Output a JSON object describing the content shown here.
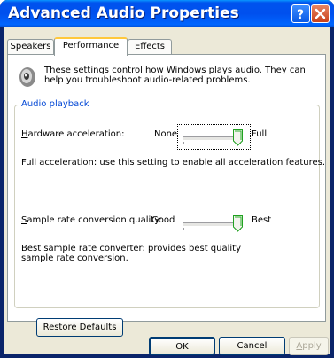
{
  "window": {
    "title": "Advanced Audio Properties"
  },
  "titlebar": {
    "help_icon": "help-question-icon",
    "close_icon": "close-x-icon"
  },
  "tabs": [
    {
      "label": "Speakers",
      "active": false
    },
    {
      "label": "Performance",
      "active": true
    },
    {
      "label": "Effects",
      "active": false
    }
  ],
  "intro": {
    "icon": "speaker-icon",
    "text": "These settings control how Windows plays audio. They can help you troubleshoot audio-related problems."
  },
  "group": {
    "title": "Audio playback"
  },
  "hardware_acceleration": {
    "label": "Hardware acceleration:",
    "min_label": "None",
    "max_label": "Full",
    "value_position": 1.0,
    "description": "Full acceleration: use this setting to enable all acceleration features."
  },
  "sample_rate_quality": {
    "label": "Sample rate conversion quality:",
    "min_label": "Good",
    "max_label": "Best",
    "value_position": 1.0,
    "description": "Best sample rate converter:  provides best quality sample rate conversion."
  },
  "buttons": {
    "restore_defaults": "Restore Defaults",
    "ok": "OK",
    "cancel": "Cancel",
    "apply": "Apply"
  },
  "colors": {
    "titlebar_blue": "#0053ee",
    "dialog_bg": "#ece9d8",
    "group_title": "#0046d5",
    "close_red": "#c9411a"
  }
}
